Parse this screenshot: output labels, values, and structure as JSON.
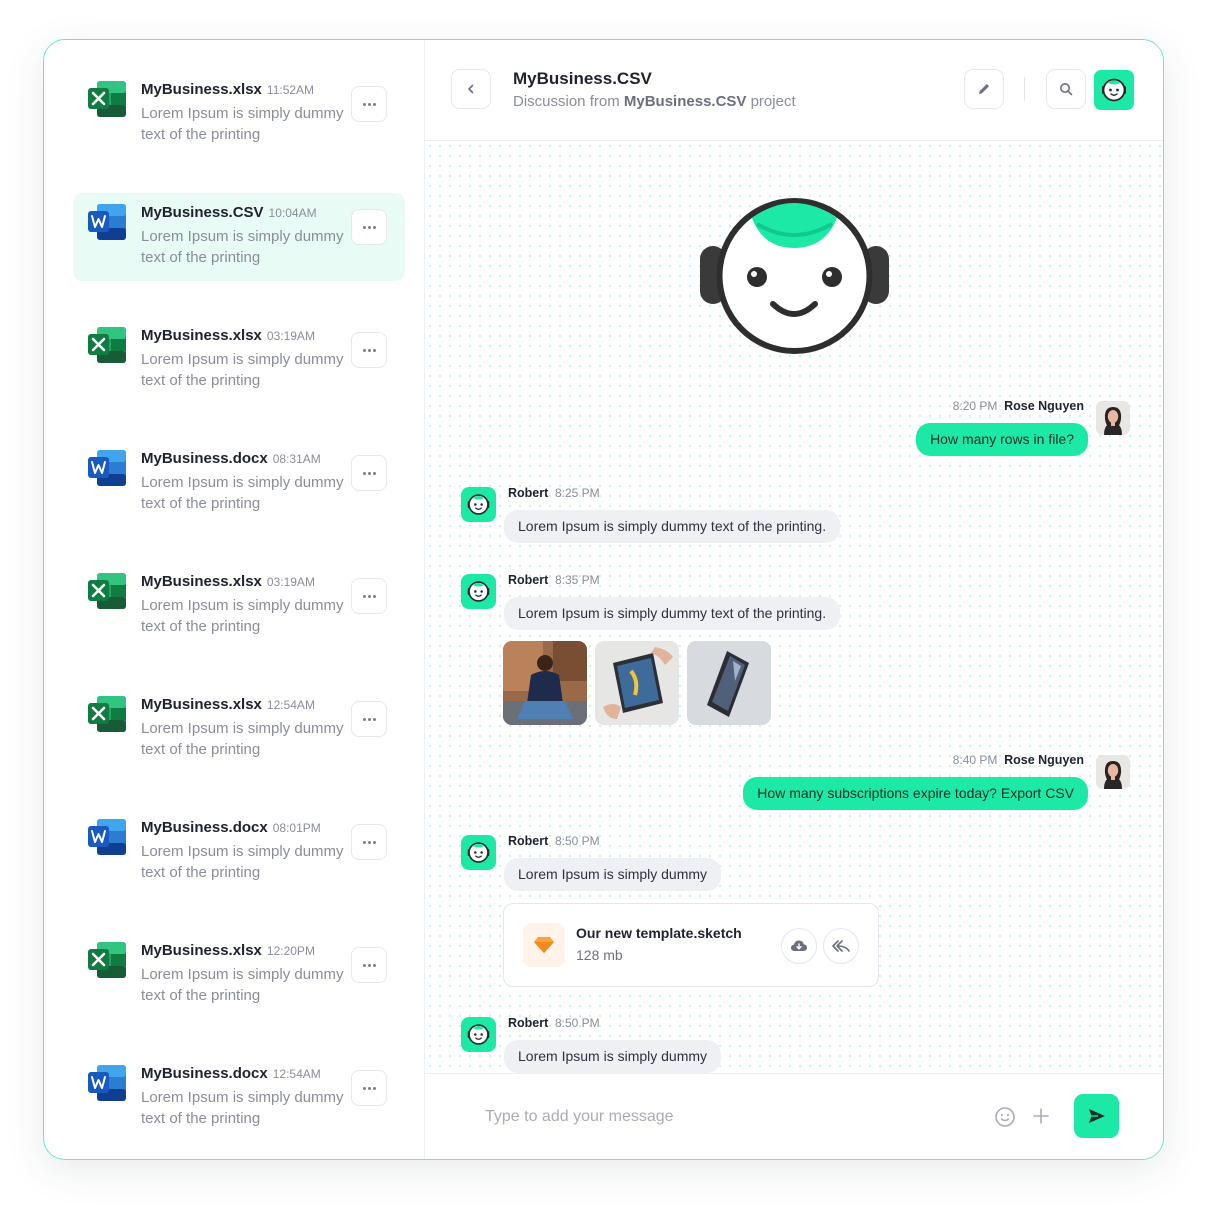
{
  "conversations": [
    {
      "title": "MyBusiness.xlsx",
      "time": "11:52AM",
      "preview": "Lorem Ipsum is simply dummy text of the printing",
      "type": "excel",
      "icon": "excel-icon",
      "active": false
    },
    {
      "title": "MyBusiness.CSV",
      "time": "10:04AM",
      "preview": "Lorem Ipsum is simply dummy text of the printing",
      "type": "word",
      "icon": "word-icon",
      "active": true
    },
    {
      "title": "MyBusiness.xlsx",
      "time": "03:19AM",
      "preview": "Lorem Ipsum is simply dummy text of the printing",
      "type": "excel",
      "icon": "excel-icon",
      "active": false
    },
    {
      "title": "MyBusiness.docx",
      "time": "08:31AM",
      "preview": "Lorem Ipsum is simply dummy text of the printing",
      "type": "word",
      "icon": "word-icon",
      "active": false
    },
    {
      "title": "MyBusiness.xlsx",
      "time": "03:19AM",
      "preview": "Lorem Ipsum is simply dummy text of the printing",
      "type": "excel",
      "icon": "excel-icon",
      "active": false
    },
    {
      "title": "MyBusiness.xlsx",
      "time": "12:54AM",
      "preview": "Lorem Ipsum is simply dummy text of the printing",
      "type": "excel",
      "icon": "excel-icon",
      "active": false
    },
    {
      "title": "MyBusiness.docx",
      "time": "08:01PM",
      "preview": "Lorem Ipsum is simply dummy text of the printing",
      "type": "word",
      "icon": "word-icon",
      "active": false
    },
    {
      "title": "MyBusiness.xlsx",
      "time": "12:20PM",
      "preview": "Lorem Ipsum is simply dummy text of the printing",
      "type": "excel",
      "icon": "excel-icon",
      "active": false
    },
    {
      "title": "MyBusiness.docx",
      "time": "12:54AM",
      "preview": "Lorem Ipsum is simply dummy text of the printing",
      "type": "word",
      "icon": "word-icon",
      "active": false
    }
  ],
  "header": {
    "title": "MyBusiness.CSV",
    "subtitle_prefix": "Discussion from",
    "subtitle_project": "MyBusiness.CSV",
    "subtitle_suffix": "project"
  },
  "messages": [
    {
      "time": "8:20 PM",
      "sender": "Rose Nguyen",
      "text": "How many rows in file?"
    },
    {
      "sender": "Robert",
      "time": "8:25 PM",
      "text": "Lorem Ipsum is simply dummy text of the printing."
    },
    {
      "sender": "Robert",
      "time": "8:35 PM",
      "text": "Lorem Ipsum is simply dummy text of the printing."
    },
    {
      "time": "8:40 PM",
      "sender": "Rose Nguyen",
      "text": "How many subscriptions expire today? Export CSV"
    },
    {
      "sender": "Robert",
      "time": "8:50 PM",
      "text": "Lorem Ipsum is simply dummy"
    },
    {
      "sender": "Robert",
      "time": "8:50 PM",
      "text": "Lorem Ipsum is simply dummy"
    }
  ],
  "attachment": {
    "name": "Our new template.sketch",
    "size": "128 mb"
  },
  "composer": {
    "placeholder": "Type to add your message"
  },
  "colors": {
    "accent": "#1de9a6",
    "border": "#66ecc0",
    "excel": "#107c41",
    "word": "#185abd",
    "sketch": "#f7a23b"
  }
}
